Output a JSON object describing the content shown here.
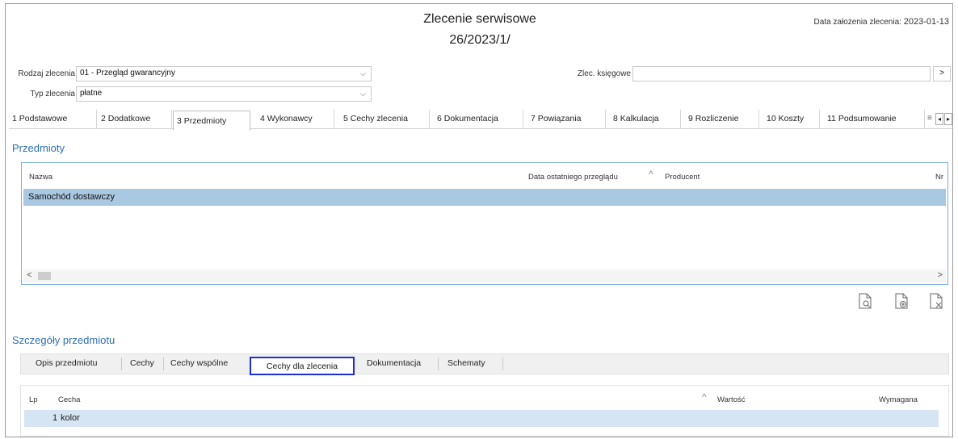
{
  "header": {
    "title_line1": "Zlecenie serwisowe",
    "title_line2": "26/2023/1/",
    "date_label": "Data założenia zlecenia:",
    "date_value": "2023-01-13"
  },
  "form": {
    "rodzaj_label": "Rodzaj zlecenia",
    "rodzaj_value": "01 - Przegląd gwarancyjny",
    "typ_label": "Typ zlecenia",
    "typ_value": "płatne",
    "zlec_label": "Zlec. księgowe",
    "zlec_value": "",
    "zlec_button": ">"
  },
  "tabs": [
    {
      "label": "1 Podstawowe"
    },
    {
      "label": "2 Dodatkowe"
    },
    {
      "label": "3 Przedmioty"
    },
    {
      "label": "4 Wykonawcy"
    },
    {
      "label": "5 Cechy zlecenia"
    },
    {
      "label": "6 Dokumentacja"
    },
    {
      "label": "7 Powiązania"
    },
    {
      "label": "8 Kalkulacja"
    },
    {
      "label": "9 Rozliczenie"
    },
    {
      "label": "10 Koszty"
    },
    {
      "label": "11 Podsumowanie"
    }
  ],
  "tab_scroll": {
    "menu": "≡",
    "left": "◂",
    "right": "▸"
  },
  "przedmioty": {
    "section_title": "Przedmioty",
    "columns": [
      "Nazwa",
      "Data ostatniego przeglądu",
      "Producent",
      "Nr"
    ],
    "sort_glyph": "^",
    "rows": [
      {
        "nazwa": "Samochód dostawczy"
      }
    ],
    "scroll_left": "<",
    "scroll_right": ">"
  },
  "actions": [
    "preview-document-icon",
    "add-document-icon",
    "delete-document-icon"
  ],
  "szczegoly": {
    "section_title": "Szczegóły przedmiotu",
    "subtabs": [
      {
        "label": "Opis przedmiotu"
      },
      {
        "label": "Cechy"
      },
      {
        "label": "Cechy wspólne"
      },
      {
        "label": "Cechy dla zlecenia"
      },
      {
        "label": "Dokumentacja"
      },
      {
        "label": "Schematy"
      }
    ],
    "columns": [
      "Lp",
      "Cecha",
      "Wartość",
      "Wymagana"
    ],
    "sort_glyph": "^",
    "rows": [
      {
        "lp": "1",
        "cecha": "kolor"
      }
    ]
  },
  "colors": {
    "accent": "#2f6fb5",
    "selection": "#a9c8e2",
    "highlight_border": "#1a2fd6"
  }
}
